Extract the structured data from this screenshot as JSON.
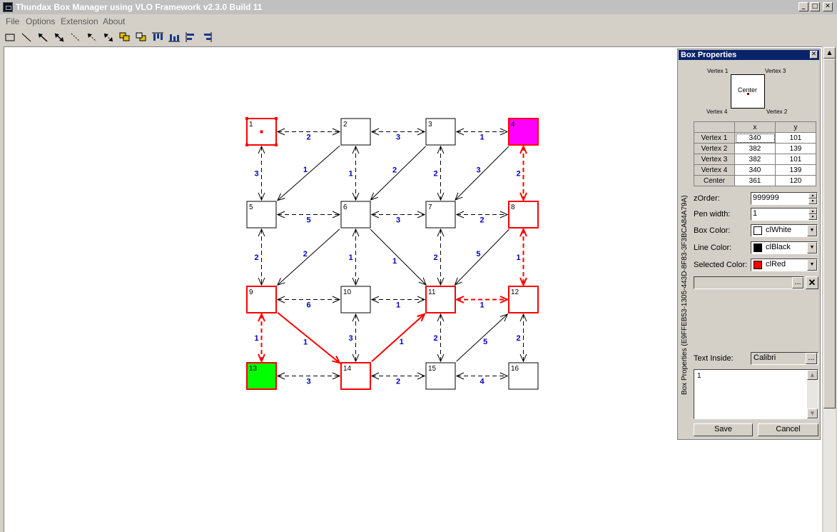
{
  "window": {
    "title": "Thundax Box Manager using VLO Framework v2.3.0 Build 11",
    "minimize": "_",
    "maximize": "□",
    "close": "✕"
  },
  "menu": [
    "File",
    "Options",
    "Extension",
    "About"
  ],
  "toolbar": [
    "rectangle-tool-icon",
    "line-tool-icon",
    "arrow-tool-icon",
    "double-arrow-tool-icon",
    "dashed-line-tool-icon",
    "dashed-arrow-tool-icon",
    "dashed-double-arrow-tool-icon",
    "bring-to-front-icon",
    "send-to-back-icon",
    "align-top-icon",
    "align-bottom-icon",
    "align-left-icon",
    "align-right-icon"
  ],
  "colors": {
    "selected": "#ff0000",
    "magenta": "#ff00ff",
    "green": "#00ff00",
    "edge_label": "#0000c0"
  },
  "diagram": {
    "boxes": [
      {
        "id": "1",
        "label": "1",
        "fill": "#ffffff",
        "red": true,
        "selected": true
      },
      {
        "id": "2",
        "label": "2",
        "fill": "#ffffff",
        "red": false
      },
      {
        "id": "3",
        "label": "3",
        "fill": "#ffffff",
        "red": false
      },
      {
        "id": "4",
        "label": "4",
        "fill": "#ff00ff",
        "red": true
      },
      {
        "id": "5",
        "label": "5",
        "fill": "#ffffff",
        "red": false
      },
      {
        "id": "6",
        "label": "6",
        "fill": "#ffffff",
        "red": false
      },
      {
        "id": "7",
        "label": "7",
        "fill": "#ffffff",
        "red": false
      },
      {
        "id": "8",
        "label": "8",
        "fill": "#ffffff",
        "red": true
      },
      {
        "id": "9",
        "label": "9",
        "fill": "#ffffff",
        "red": true
      },
      {
        "id": "10",
        "label": "10",
        "fill": "#ffffff",
        "red": false
      },
      {
        "id": "11",
        "label": "11",
        "fill": "#ffffff",
        "red": true
      },
      {
        "id": "12",
        "label": "12",
        "fill": "#ffffff",
        "red": true
      },
      {
        "id": "13",
        "label": "13",
        "fill": "#00ff00",
        "red": true
      },
      {
        "id": "14",
        "label": "14",
        "fill": "#ffffff",
        "red": true
      },
      {
        "id": "15",
        "label": "15",
        "fill": "#ffffff",
        "red": false
      },
      {
        "id": "16",
        "label": "16",
        "fill": "#ffffff",
        "red": false
      }
    ],
    "edges": [
      {
        "from": "1",
        "to": "2",
        "weight": "2",
        "dashed": true,
        "bidir": true,
        "red": false
      },
      {
        "from": "2",
        "to": "3",
        "weight": "3",
        "dashed": true,
        "bidir": true,
        "red": false
      },
      {
        "from": "3",
        "to": "4",
        "weight": "1",
        "dashed": true,
        "bidir": true,
        "red": false
      },
      {
        "from": "1",
        "to": "5",
        "weight": "3",
        "dashed": true,
        "bidir": true,
        "red": false
      },
      {
        "from": "2",
        "to": "5",
        "weight": "1",
        "dashed": false,
        "bidir": false,
        "red": false
      },
      {
        "from": "2",
        "to": "6",
        "weight": "1",
        "dashed": true,
        "bidir": true,
        "red": false
      },
      {
        "from": "3",
        "to": "6",
        "weight": "2",
        "dashed": false,
        "bidir": false,
        "red": false
      },
      {
        "from": "3",
        "to": "7",
        "weight": "2",
        "dashed": true,
        "bidir": true,
        "red": false
      },
      {
        "from": "4",
        "to": "7",
        "weight": "3",
        "dashed": false,
        "bidir": false,
        "red": false
      },
      {
        "from": "4",
        "to": "8",
        "weight": "2",
        "dashed": true,
        "bidir": true,
        "red": true
      },
      {
        "from": "5",
        "to": "6",
        "weight": "5",
        "dashed": true,
        "bidir": true,
        "red": false
      },
      {
        "from": "6",
        "to": "7",
        "weight": "3",
        "dashed": true,
        "bidir": true,
        "red": false
      },
      {
        "from": "7",
        "to": "8",
        "weight": "2",
        "dashed": true,
        "bidir": true,
        "red": false
      },
      {
        "from": "5",
        "to": "9",
        "weight": "2",
        "dashed": true,
        "bidir": true,
        "red": false
      },
      {
        "from": "6",
        "to": "9",
        "weight": "2",
        "dashed": false,
        "bidir": false,
        "red": false
      },
      {
        "from": "6",
        "to": "10",
        "weight": "1",
        "dashed": true,
        "bidir": true,
        "red": false
      },
      {
        "from": "6",
        "to": "11",
        "weight": "1",
        "dashed": false,
        "bidir": false,
        "red": false
      },
      {
        "from": "7",
        "to": "11",
        "weight": "2",
        "dashed": true,
        "bidir": true,
        "red": false
      },
      {
        "from": "8",
        "to": "11",
        "weight": "5",
        "dashed": false,
        "bidir": false,
        "red": false
      },
      {
        "from": "8",
        "to": "12",
        "weight": "1",
        "dashed": true,
        "bidir": true,
        "red": true
      },
      {
        "from": "9",
        "to": "10",
        "weight": "6",
        "dashed": true,
        "bidir": true,
        "red": false
      },
      {
        "from": "10",
        "to": "11",
        "weight": "1",
        "dashed": true,
        "bidir": true,
        "red": false
      },
      {
        "from": "11",
        "to": "12",
        "weight": "1",
        "dashed": true,
        "bidir": true,
        "red": true
      },
      {
        "from": "9",
        "to": "13",
        "weight": "1",
        "dashed": true,
        "bidir": true,
        "red": true
      },
      {
        "from": "9",
        "to": "14",
        "weight": "1",
        "dashed": false,
        "bidir": false,
        "red": true
      },
      {
        "from": "10",
        "to": "14",
        "weight": "3",
        "dashed": true,
        "bidir": true,
        "red": false
      },
      {
        "from": "14",
        "to": "11",
        "weight": "1",
        "dashed": false,
        "bidir": false,
        "red": true
      },
      {
        "from": "11",
        "to": "15",
        "weight": "2",
        "dashed": true,
        "bidir": true,
        "red": false
      },
      {
        "from": "15",
        "to": "12",
        "weight": "5",
        "dashed": false,
        "bidir": false,
        "red": false
      },
      {
        "from": "12",
        "to": "16",
        "weight": "2",
        "dashed": true,
        "bidir": true,
        "red": false
      },
      {
        "from": "13",
        "to": "14",
        "weight": "3",
        "dashed": true,
        "bidir": true,
        "red": false
      },
      {
        "from": "14",
        "to": "15",
        "weight": "2",
        "dashed": true,
        "bidir": true,
        "red": false
      },
      {
        "from": "15",
        "to": "16",
        "weight": "4",
        "dashed": true,
        "bidir": true,
        "red": false
      }
    ]
  },
  "panel": {
    "title": "Box Properties",
    "close": "✕",
    "side_label": "Box Properties (E9FFEB53-1305-443D-8F83-3F3BCA84A79A)",
    "preview": {
      "v1": "Vertex 1",
      "v2": "Vertex 2",
      "v3": "Vertex 3",
      "v4": "Vertex 4",
      "center": "Center"
    },
    "table": {
      "headers": [
        "x",
        "y"
      ],
      "rows": [
        {
          "name": "Vertex 1",
          "x": "340",
          "y": "101"
        },
        {
          "name": "Vertex 2",
          "x": "382",
          "y": "139"
        },
        {
          "name": "Vertex 3",
          "x": "382",
          "y": "101"
        },
        {
          "name": "Vertex 4",
          "x": "340",
          "y": "139"
        },
        {
          "name": "Center",
          "x": "361",
          "y": "120"
        }
      ]
    },
    "zorder_label": "zOrder:",
    "zorder_value": "999999",
    "penwidth_label": "Pen width:",
    "penwidth_value": "1",
    "boxcolor_label": "Box Color:",
    "boxcolor_value": "clWhite",
    "boxcolor_swatch": "#ffffff",
    "linecolor_label": "Line Color:",
    "linecolor_value": "clBlack",
    "linecolor_swatch": "#000000",
    "selcolor_label": "Selected Color:",
    "selcolor_value": "clRed",
    "selcolor_swatch": "#ff0000",
    "browse": "...",
    "text_inside_label": "Text Inside:",
    "text_inside_font": "Calibri",
    "memo_text": "1",
    "save": "Save",
    "cancel": "Cancel"
  }
}
